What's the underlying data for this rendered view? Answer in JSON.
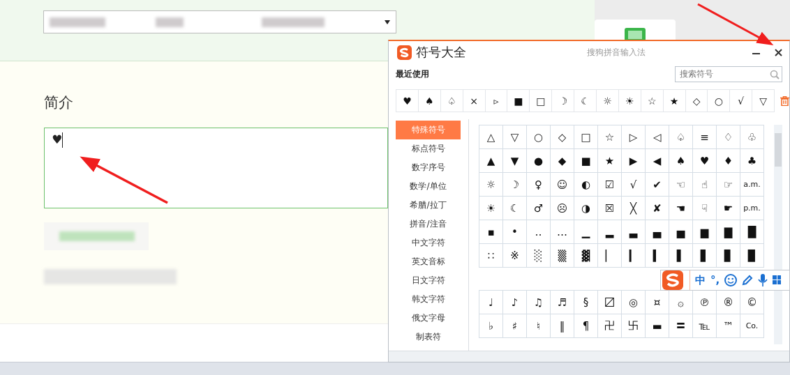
{
  "page": {
    "section_title": "简介",
    "textarea": {
      "value": "♥"
    }
  },
  "symbol_panel": {
    "title": "符号大全",
    "subtitle": "搜狗拼音输入法",
    "recent_label": "最近使用",
    "search": {
      "placeholder": "搜索符号"
    },
    "recent": [
      "♥",
      "♠",
      "♤",
      "×",
      "▹",
      "■",
      "□",
      "☽",
      "☾",
      "☼",
      "☀",
      "☆",
      "★",
      "◇",
      "○",
      "√",
      "▽"
    ],
    "categories": [
      {
        "label": "特殊符号",
        "selected": true
      },
      {
        "label": "标点符号",
        "selected": false
      },
      {
        "label": "数字序号",
        "selected": false
      },
      {
        "label": "数学/单位",
        "selected": false
      },
      {
        "label": "希腊/拉丁",
        "selected": false
      },
      {
        "label": "拼音/注音",
        "selected": false
      },
      {
        "label": "中文字符",
        "selected": false
      },
      {
        "label": "英文音标",
        "selected": false
      },
      {
        "label": "日文字符",
        "selected": false
      },
      {
        "label": "韩文字符",
        "selected": false
      },
      {
        "label": "俄文字母",
        "selected": false
      },
      {
        "label": "制表符",
        "selected": false
      }
    ],
    "grid_1": [
      [
        "△",
        "▽",
        "○",
        "◇",
        "□",
        "☆",
        "▷",
        "◁",
        "♤",
        "≡",
        "♢",
        "♧"
      ],
      [
        "▲",
        "▼",
        "●",
        "◆",
        "■",
        "★",
        "▶",
        "◀",
        "♠",
        "♥",
        "♦",
        "♣"
      ],
      [
        "☼",
        "☽",
        "♀",
        "☺",
        "◐",
        "☑",
        "√",
        "✔",
        "☜",
        "☝",
        "☞",
        "a.m."
      ],
      [
        "☀",
        "☾",
        "♂",
        "☹",
        "◑",
        "☒",
        "╳",
        "✘",
        "☚",
        "☟",
        "☛",
        "p.m."
      ],
      [
        "▪",
        "•",
        "‥",
        "…",
        "▁",
        "▂",
        "▃",
        "▄",
        "▅",
        "▆",
        "▇",
        "█"
      ],
      [
        "∷",
        "※",
        "░",
        "▒",
        "▓",
        "▏",
        "▎",
        "▍",
        "▌",
        "▋",
        "▊",
        "▉"
      ]
    ],
    "grid_2": [
      [
        "♩",
        "♪",
        "♫",
        "♬",
        "§",
        "〼",
        "◎",
        "¤",
        "۞",
        "℗",
        "®",
        "©"
      ],
      [
        "♭",
        "♯",
        "♮",
        "‖",
        "¶",
        "卍",
        "卐",
        "▬",
        "〓",
        "℡",
        "™",
        "Co."
      ]
    ]
  },
  "ime_toolbar": {
    "mode": "中",
    "punctuation": "°,"
  }
}
